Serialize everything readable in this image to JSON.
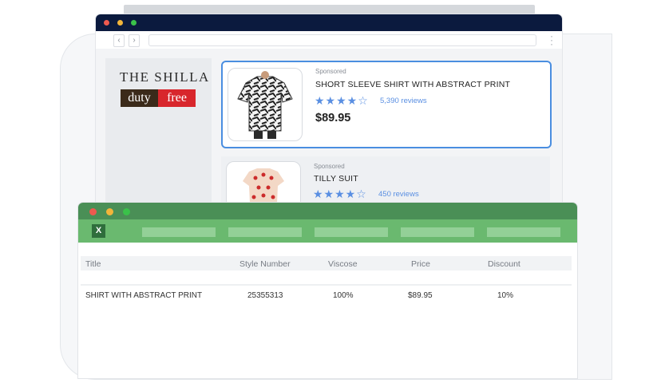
{
  "browser": {
    "nav": {
      "back": "‹",
      "forward": "›"
    },
    "logo": {
      "title": "THE SHILLA",
      "duty": "duty",
      "free": "free"
    },
    "products": [
      {
        "sponsored": "Sponsored",
        "title": "SHORT SLEEVE SHIRT WITH ABSTRACT PRINT",
        "stars": "★★★★☆",
        "reviews": "5,390 reviews",
        "price": "$89.95",
        "rating": 4
      },
      {
        "sponsored": "Sponsored",
        "title": "TILLY SUIT",
        "stars": "★★★★☆",
        "reviews": "450 reviews",
        "rating": 4
      }
    ]
  },
  "sheet": {
    "icon_label": "X",
    "headers": [
      "Title",
      "Style Number",
      "Viscose",
      "Price",
      "Discount"
    ],
    "row": [
      "SHIRT WITH ABSTRACT PRINT",
      "25355313",
      "100%",
      "$89.95",
      "10%"
    ]
  },
  "colors": {
    "browser_titlebar": "#0b1a3e",
    "sheet_titlebar": "#4a8f56",
    "sheet_ribbon": "#6ab96f",
    "accent_blue": "#4a8ee0",
    "star_blue": "#5a8fe2",
    "dot_red": "#ee5a4f",
    "dot_yellow": "#f2b53a",
    "dot_green": "#3ac24a"
  }
}
